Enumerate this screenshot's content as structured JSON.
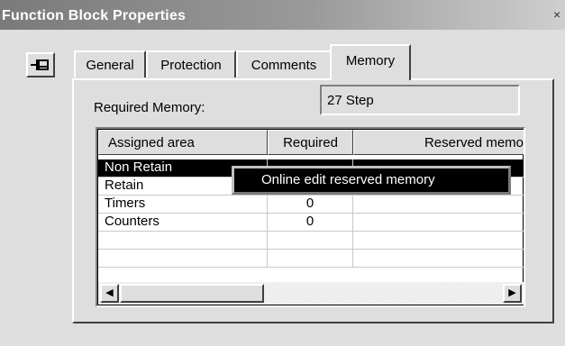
{
  "window": {
    "title": "Function Block Properties",
    "close_glyph": "×"
  },
  "toolbar": {
    "pin_icon": "pin-icon"
  },
  "tabs": [
    {
      "label": "General",
      "active": false
    },
    {
      "label": "Protection",
      "active": false
    },
    {
      "label": "Comments",
      "active": false
    },
    {
      "label": "Memory",
      "active": true
    }
  ],
  "memory": {
    "required_label": "Required Memory:",
    "required_value": "27 Step"
  },
  "grid": {
    "columns": [
      "Assigned area",
      "Required",
      "Reserved memo"
    ],
    "rows": [
      {
        "area": "Non Retain",
        "required": "",
        "reserved": "",
        "selected": true
      },
      {
        "area": "Retain",
        "required": "",
        "reserved": "",
        "selected": false
      },
      {
        "area": "Timers",
        "required": "0",
        "reserved": "",
        "selected": false
      },
      {
        "area": "Counters",
        "required": "0",
        "reserved": "",
        "selected": false
      },
      {
        "area": "",
        "required": "",
        "reserved": "",
        "selected": false
      },
      {
        "area": "",
        "required": "",
        "reserved": "",
        "selected": false
      }
    ]
  },
  "scrollbar": {
    "left_arrow": "◀",
    "right_arrow": "▶"
  },
  "context_menu": {
    "item": "Online edit reserved memory"
  }
}
